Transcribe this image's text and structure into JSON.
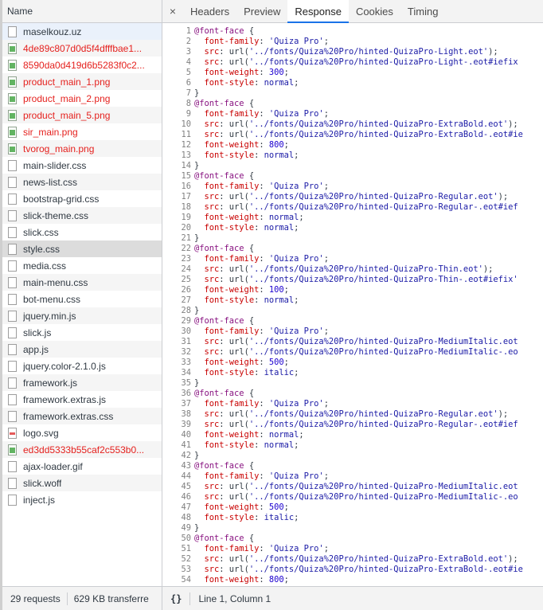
{
  "left": {
    "header": "Name",
    "files": [
      {
        "name": "maselkouz.uz",
        "type": "doc",
        "error": false
      },
      {
        "name": "4de89c807d0d5f4dfffbae1...",
        "type": "img",
        "error": true
      },
      {
        "name": "8590da0d419d6b5283f0c2...",
        "type": "img",
        "error": true
      },
      {
        "name": "product_main_1.png",
        "type": "img",
        "error": true
      },
      {
        "name": "product_main_2.png",
        "type": "img",
        "error": true
      },
      {
        "name": "product_main_5.png",
        "type": "img",
        "error": true
      },
      {
        "name": "sir_main.png",
        "type": "img",
        "error": true
      },
      {
        "name": "tvorog_main.png",
        "type": "img",
        "error": true
      },
      {
        "name": "main-slider.css",
        "type": "doc",
        "error": false
      },
      {
        "name": "news-list.css",
        "type": "doc",
        "error": false
      },
      {
        "name": "bootstrap-grid.css",
        "type": "doc",
        "error": false
      },
      {
        "name": "slick-theme.css",
        "type": "doc",
        "error": false
      },
      {
        "name": "slick.css",
        "type": "doc",
        "error": false
      },
      {
        "name": "style.css",
        "type": "doc",
        "error": false,
        "selected": true
      },
      {
        "name": "media.css",
        "type": "doc",
        "error": false
      },
      {
        "name": "main-menu.css",
        "type": "doc",
        "error": false
      },
      {
        "name": "bot-menu.css",
        "type": "doc",
        "error": false
      },
      {
        "name": "jquery.min.js",
        "type": "doc",
        "error": false
      },
      {
        "name": "slick.js",
        "type": "doc",
        "error": false
      },
      {
        "name": "app.js",
        "type": "doc",
        "error": false
      },
      {
        "name": "jquery.color-2.1.0.js",
        "type": "doc",
        "error": false
      },
      {
        "name": "framework.js",
        "type": "doc",
        "error": false
      },
      {
        "name": "framework.extras.js",
        "type": "doc",
        "error": false
      },
      {
        "name": "framework.extras.css",
        "type": "doc",
        "error": false
      },
      {
        "name": "logo.svg",
        "type": "svg",
        "error": false
      },
      {
        "name": "ed3dd5333b55caf2c553b0...",
        "type": "img",
        "error": true
      },
      {
        "name": "ajax-loader.gif",
        "type": "doc",
        "error": false
      },
      {
        "name": "slick.woff",
        "type": "doc",
        "error": false
      },
      {
        "name": "inject.js",
        "type": "doc",
        "error": false
      }
    ],
    "footer": {
      "requests": "29 requests",
      "transferred": "629 KB transferre"
    }
  },
  "right": {
    "close_icon": "×",
    "tabs": [
      {
        "label": "Headers",
        "active": false
      },
      {
        "label": "Preview",
        "active": false
      },
      {
        "label": "Response",
        "active": true
      },
      {
        "label": "Cookies",
        "active": false
      },
      {
        "label": "Timing",
        "active": false
      }
    ],
    "code_lines": [
      "@font-face {",
      "  font-family: 'Quiza Pro';",
      "  src: url('../fonts/Quiza%20Pro/hinted-QuizaPro-Light.eot');",
      "  src: url('../fonts/Quiza%20Pro/hinted-QuizaPro-Light-.eot#iefix",
      "  font-weight: 300;",
      "  font-style: normal;",
      "}",
      "@font-face {",
      "  font-family: 'Quiza Pro';",
      "  src: url('../fonts/Quiza%20Pro/hinted-QuizaPro-ExtraBold.eot');",
      "  src: url('../fonts/Quiza%20Pro/hinted-QuizaPro-ExtraBold-.eot#ie",
      "  font-weight: 800;",
      "  font-style: normal;",
      "}",
      "@font-face {",
      "  font-family: 'Quiza Pro';",
      "  src: url('../fonts/Quiza%20Pro/hinted-QuizaPro-Regular.eot');",
      "  src: url('../fonts/Quiza%20Pro/hinted-QuizaPro-Regular-.eot#ief",
      "  font-weight: normal;",
      "  font-style: normal;",
      "}",
      "@font-face {",
      "  font-family: 'Quiza Pro';",
      "  src: url('../fonts/Quiza%20Pro/hinted-QuizaPro-Thin.eot');",
      "  src: url('../fonts/Quiza%20Pro/hinted-QuizaPro-Thin-.eot#iefix'",
      "  font-weight: 100;",
      "  font-style: normal;",
      "}",
      "@font-face {",
      "  font-family: 'Quiza Pro';",
      "  src: url('../fonts/Quiza%20Pro/hinted-QuizaPro-MediumItalic.eot",
      "  src: url('../fonts/Quiza%20Pro/hinted-QuizaPro-MediumItalic-.eo",
      "  font-weight: 500;",
      "  font-style: italic;",
      "}",
      "@font-face {",
      "  font-family: 'Quiza Pro';",
      "  src: url('../fonts/Quiza%20Pro/hinted-QuizaPro-Regular.eot');",
      "  src: url('../fonts/Quiza%20Pro/hinted-QuizaPro-Regular-.eot#ief",
      "  font-weight: normal;",
      "  font-style: normal;",
      "}",
      "@font-face {",
      "  font-family: 'Quiza Pro';",
      "  src: url('../fonts/Quiza%20Pro/hinted-QuizaPro-MediumItalic.eot",
      "  src: url('../fonts/Quiza%20Pro/hinted-QuizaPro-MediumItalic-.eo",
      "  font-weight: 500;",
      "  font-style: italic;",
      "}",
      "@font-face {",
      "  font-family: 'Quiza Pro';",
      "  src: url('../fonts/Quiza%20Pro/hinted-QuizaPro-ExtraBold.eot');",
      "  src: url('../fonts/Quiza%20Pro/hinted-QuizaPro-ExtraBold-.eot#ie",
      "  font-weight: 800;"
    ],
    "footer": {
      "braces": "{}",
      "position": "Line 1, Column 1"
    }
  },
  "colors": {
    "error_text": "#e5211e",
    "active_tab_underline": "#1a73e8",
    "selected_row": "#dcdcdc"
  }
}
